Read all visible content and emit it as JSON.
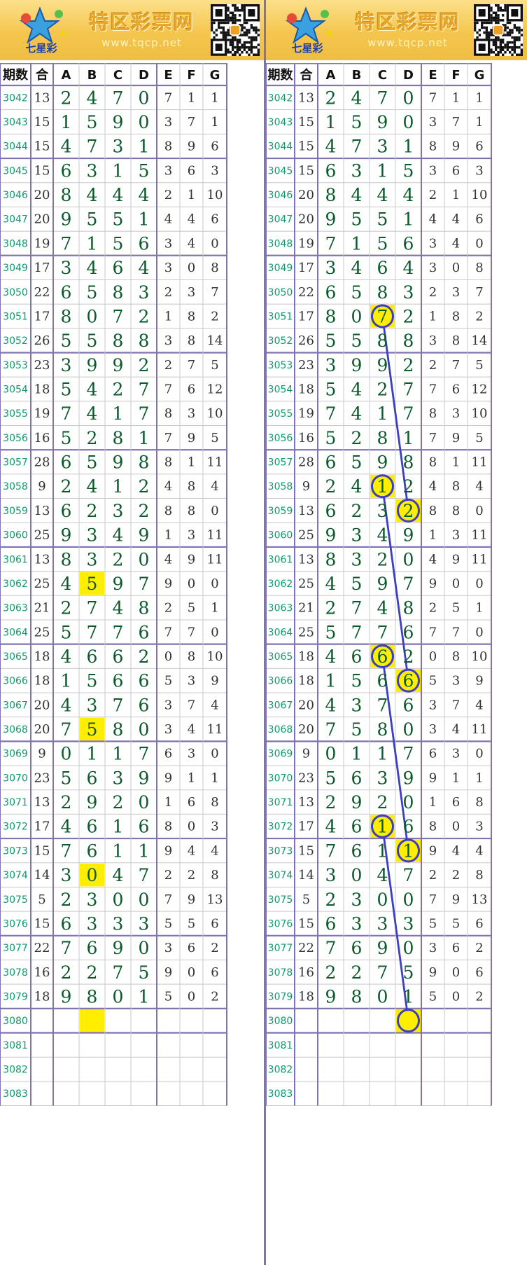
{
  "banner": {
    "title": "特区彩票网",
    "url": "www.tqcp.net",
    "logo_text": "七星彩"
  },
  "columns": [
    "期数",
    "合",
    "A",
    "B",
    "C",
    "D",
    "E",
    "F",
    "G"
  ],
  "rows": [
    {
      "period": "3042",
      "sum": "13",
      "digits": [
        "2",
        "4",
        "7",
        "0",
        "7",
        "1",
        "1"
      ]
    },
    {
      "period": "3043",
      "sum": "15",
      "digits": [
        "1",
        "5",
        "9",
        "0",
        "3",
        "7",
        "1"
      ]
    },
    {
      "period": "3044",
      "sum": "15",
      "digits": [
        "4",
        "7",
        "3",
        "1",
        "8",
        "9",
        "6"
      ]
    },
    {
      "period": "3045",
      "sum": "15",
      "digits": [
        "6",
        "3",
        "1",
        "5",
        "3",
        "6",
        "3"
      ]
    },
    {
      "period": "3046",
      "sum": "20",
      "digits": [
        "8",
        "4",
        "4",
        "4",
        "2",
        "1",
        "10"
      ]
    },
    {
      "period": "3047",
      "sum": "20",
      "digits": [
        "9",
        "5",
        "5",
        "1",
        "4",
        "4",
        "6"
      ]
    },
    {
      "period": "3048",
      "sum": "19",
      "digits": [
        "7",
        "1",
        "5",
        "6",
        "3",
        "4",
        "0"
      ]
    },
    {
      "period": "3049",
      "sum": "17",
      "digits": [
        "3",
        "4",
        "6",
        "4",
        "3",
        "0",
        "8"
      ]
    },
    {
      "period": "3050",
      "sum": "22",
      "digits": [
        "6",
        "5",
        "8",
        "3",
        "2",
        "3",
        "7"
      ]
    },
    {
      "period": "3051",
      "sum": "17",
      "digits": [
        "8",
        "0",
        "7",
        "2",
        "1",
        "8",
        "2"
      ]
    },
    {
      "period": "3052",
      "sum": "26",
      "digits": [
        "5",
        "5",
        "8",
        "8",
        "3",
        "8",
        "14"
      ]
    },
    {
      "period": "3053",
      "sum": "23",
      "digits": [
        "3",
        "9",
        "9",
        "2",
        "2",
        "7",
        "5"
      ]
    },
    {
      "period": "3054",
      "sum": "18",
      "digits": [
        "5",
        "4",
        "2",
        "7",
        "7",
        "6",
        "12"
      ]
    },
    {
      "period": "3055",
      "sum": "19",
      "digits": [
        "7",
        "4",
        "1",
        "7",
        "8",
        "3",
        "10"
      ]
    },
    {
      "period": "3056",
      "sum": "16",
      "digits": [
        "5",
        "2",
        "8",
        "1",
        "7",
        "9",
        "5"
      ]
    },
    {
      "period": "3057",
      "sum": "28",
      "digits": [
        "6",
        "5",
        "9",
        "8",
        "8",
        "1",
        "11"
      ]
    },
    {
      "period": "3058",
      "sum": "9",
      "digits": [
        "2",
        "4",
        "1",
        "2",
        "4",
        "8",
        "4"
      ]
    },
    {
      "period": "3059",
      "sum": "13",
      "digits": [
        "6",
        "2",
        "3",
        "2",
        "8",
        "8",
        "0"
      ]
    },
    {
      "period": "3060",
      "sum": "25",
      "digits": [
        "9",
        "3",
        "4",
        "9",
        "1",
        "3",
        "11"
      ]
    },
    {
      "period": "3061",
      "sum": "13",
      "digits": [
        "8",
        "3",
        "2",
        "0",
        "4",
        "9",
        "11"
      ]
    },
    {
      "period": "3062",
      "sum": "25",
      "digits": [
        "4",
        "5",
        "9",
        "7",
        "9",
        "0",
        "0"
      ]
    },
    {
      "period": "3063",
      "sum": "21",
      "digits": [
        "2",
        "7",
        "4",
        "8",
        "2",
        "5",
        "1"
      ]
    },
    {
      "period": "3064",
      "sum": "25",
      "digits": [
        "5",
        "7",
        "7",
        "6",
        "7",
        "7",
        "0"
      ]
    },
    {
      "period": "3065",
      "sum": "18",
      "digits": [
        "4",
        "6",
        "6",
        "2",
        "0",
        "8",
        "10"
      ]
    },
    {
      "period": "3066",
      "sum": "18",
      "digits": [
        "1",
        "5",
        "6",
        "6",
        "5",
        "3",
        "9"
      ]
    },
    {
      "period": "3067",
      "sum": "20",
      "digits": [
        "4",
        "3",
        "7",
        "6",
        "3",
        "7",
        "4"
      ]
    },
    {
      "period": "3068",
      "sum": "20",
      "digits": [
        "7",
        "5",
        "8",
        "0",
        "3",
        "4",
        "11"
      ]
    },
    {
      "period": "3069",
      "sum": "9",
      "digits": [
        "0",
        "1",
        "1",
        "7",
        "6",
        "3",
        "0"
      ]
    },
    {
      "period": "3070",
      "sum": "23",
      "digits": [
        "5",
        "6",
        "3",
        "9",
        "9",
        "1",
        "1"
      ]
    },
    {
      "period": "3071",
      "sum": "13",
      "digits": [
        "2",
        "9",
        "2",
        "0",
        "1",
        "6",
        "8"
      ]
    },
    {
      "period": "3072",
      "sum": "17",
      "digits": [
        "4",
        "6",
        "1",
        "6",
        "8",
        "0",
        "3"
      ]
    },
    {
      "period": "3073",
      "sum": "15",
      "digits": [
        "7",
        "6",
        "1",
        "1",
        "9",
        "4",
        "4"
      ]
    },
    {
      "period": "3074",
      "sum": "14",
      "digits": [
        "3",
        "0",
        "4",
        "7",
        "2",
        "2",
        "8"
      ]
    },
    {
      "period": "3075",
      "sum": "5",
      "digits": [
        "2",
        "3",
        "0",
        "0",
        "7",
        "9",
        "13"
      ]
    },
    {
      "period": "3076",
      "sum": "15",
      "digits": [
        "6",
        "3",
        "3",
        "3",
        "5",
        "5",
        "6"
      ]
    },
    {
      "period": "3077",
      "sum": "22",
      "digits": [
        "7",
        "6",
        "9",
        "0",
        "3",
        "6",
        "2"
      ]
    },
    {
      "period": "3078",
      "sum": "16",
      "digits": [
        "2",
        "2",
        "7",
        "5",
        "9",
        "0",
        "6"
      ]
    },
    {
      "period": "3079",
      "sum": "18",
      "digits": [
        "9",
        "8",
        "0",
        "1",
        "5",
        "0",
        "2"
      ]
    },
    {
      "period": "3080",
      "sum": "",
      "digits": [
        "",
        "",
        "",
        "",
        "",
        "",
        ""
      ]
    },
    {
      "period": "3081",
      "sum": "",
      "digits": [
        "",
        "",
        "",
        "",
        "",
        "",
        ""
      ]
    },
    {
      "period": "3082",
      "sum": "",
      "digits": [
        "",
        "",
        "",
        "",
        "",
        "",
        ""
      ]
    },
    {
      "period": "3083",
      "sum": "",
      "digits": [
        "",
        "",
        "",
        "",
        "",
        "",
        ""
      ]
    }
  ],
  "left_highlights": [
    {
      "row": 20,
      "col": 1
    },
    {
      "row": 26,
      "col": 1
    },
    {
      "row": 32,
      "col": 1
    },
    {
      "row": 38,
      "col": 1
    }
  ],
  "right_circles": [
    {
      "row": 9,
      "col": 2
    },
    {
      "row": 16,
      "col": 2
    },
    {
      "row": 17,
      "col": 3
    },
    {
      "row": 23,
      "col": 2
    },
    {
      "row": 24,
      "col": 3
    },
    {
      "row": 30,
      "col": 2
    },
    {
      "row": 31,
      "col": 3
    },
    {
      "row": 38,
      "col": 3
    }
  ],
  "right_lines": [
    [
      {
        "row": 9,
        "col": 2
      },
      {
        "row": 17,
        "col": 3
      }
    ],
    [
      {
        "row": 16,
        "col": 2
      },
      {
        "row": 24,
        "col": 3
      }
    ],
    [
      {
        "row": 23,
        "col": 2
      },
      {
        "row": 31,
        "col": 3
      }
    ],
    [
      {
        "row": 30,
        "col": 2
      },
      {
        "row": 38,
        "col": 3
      }
    ]
  ],
  "colors": {
    "highlight": "#ffee00",
    "circle_stroke": "#3a3fc4",
    "line": "#3b3fc2",
    "grid_line": "#c8c8c8",
    "group_line": "#7f72b5",
    "period_text": "#0f9a6a",
    "big_digit": "#0a5a2a"
  }
}
